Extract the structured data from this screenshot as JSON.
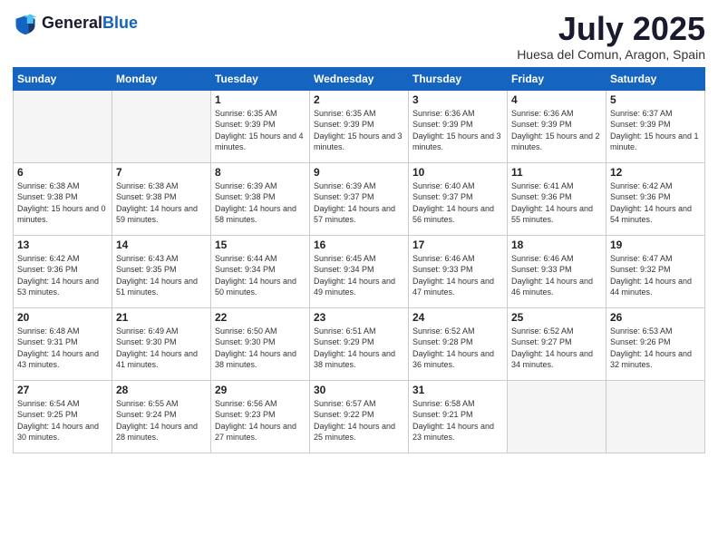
{
  "header": {
    "logo_general": "General",
    "logo_blue": "Blue",
    "month_title": "July 2025",
    "location": "Huesa del Comun, Aragon, Spain"
  },
  "weekdays": [
    "Sunday",
    "Monday",
    "Tuesday",
    "Wednesday",
    "Thursday",
    "Friday",
    "Saturday"
  ],
  "weeks": [
    [
      {
        "day": "",
        "empty": true
      },
      {
        "day": "",
        "empty": true
      },
      {
        "day": "1",
        "sunrise": "Sunrise: 6:35 AM",
        "sunset": "Sunset: 9:39 PM",
        "daylight": "Daylight: 15 hours and 4 minutes."
      },
      {
        "day": "2",
        "sunrise": "Sunrise: 6:35 AM",
        "sunset": "Sunset: 9:39 PM",
        "daylight": "Daylight: 15 hours and 3 minutes."
      },
      {
        "day": "3",
        "sunrise": "Sunrise: 6:36 AM",
        "sunset": "Sunset: 9:39 PM",
        "daylight": "Daylight: 15 hours and 3 minutes."
      },
      {
        "day": "4",
        "sunrise": "Sunrise: 6:36 AM",
        "sunset": "Sunset: 9:39 PM",
        "daylight": "Daylight: 15 hours and 2 minutes."
      },
      {
        "day": "5",
        "sunrise": "Sunrise: 6:37 AM",
        "sunset": "Sunset: 9:39 PM",
        "daylight": "Daylight: 15 hours and 1 minute."
      }
    ],
    [
      {
        "day": "6",
        "sunrise": "Sunrise: 6:38 AM",
        "sunset": "Sunset: 9:38 PM",
        "daylight": "Daylight: 15 hours and 0 minutes."
      },
      {
        "day": "7",
        "sunrise": "Sunrise: 6:38 AM",
        "sunset": "Sunset: 9:38 PM",
        "daylight": "Daylight: 14 hours and 59 minutes."
      },
      {
        "day": "8",
        "sunrise": "Sunrise: 6:39 AM",
        "sunset": "Sunset: 9:38 PM",
        "daylight": "Daylight: 14 hours and 58 minutes."
      },
      {
        "day": "9",
        "sunrise": "Sunrise: 6:39 AM",
        "sunset": "Sunset: 9:37 PM",
        "daylight": "Daylight: 14 hours and 57 minutes."
      },
      {
        "day": "10",
        "sunrise": "Sunrise: 6:40 AM",
        "sunset": "Sunset: 9:37 PM",
        "daylight": "Daylight: 14 hours and 56 minutes."
      },
      {
        "day": "11",
        "sunrise": "Sunrise: 6:41 AM",
        "sunset": "Sunset: 9:36 PM",
        "daylight": "Daylight: 14 hours and 55 minutes."
      },
      {
        "day": "12",
        "sunrise": "Sunrise: 6:42 AM",
        "sunset": "Sunset: 9:36 PM",
        "daylight": "Daylight: 14 hours and 54 minutes."
      }
    ],
    [
      {
        "day": "13",
        "sunrise": "Sunrise: 6:42 AM",
        "sunset": "Sunset: 9:36 PM",
        "daylight": "Daylight: 14 hours and 53 minutes."
      },
      {
        "day": "14",
        "sunrise": "Sunrise: 6:43 AM",
        "sunset": "Sunset: 9:35 PM",
        "daylight": "Daylight: 14 hours and 51 minutes."
      },
      {
        "day": "15",
        "sunrise": "Sunrise: 6:44 AM",
        "sunset": "Sunset: 9:34 PM",
        "daylight": "Daylight: 14 hours and 50 minutes."
      },
      {
        "day": "16",
        "sunrise": "Sunrise: 6:45 AM",
        "sunset": "Sunset: 9:34 PM",
        "daylight": "Daylight: 14 hours and 49 minutes."
      },
      {
        "day": "17",
        "sunrise": "Sunrise: 6:46 AM",
        "sunset": "Sunset: 9:33 PM",
        "daylight": "Daylight: 14 hours and 47 minutes."
      },
      {
        "day": "18",
        "sunrise": "Sunrise: 6:46 AM",
        "sunset": "Sunset: 9:33 PM",
        "daylight": "Daylight: 14 hours and 46 minutes."
      },
      {
        "day": "19",
        "sunrise": "Sunrise: 6:47 AM",
        "sunset": "Sunset: 9:32 PM",
        "daylight": "Daylight: 14 hours and 44 minutes."
      }
    ],
    [
      {
        "day": "20",
        "sunrise": "Sunrise: 6:48 AM",
        "sunset": "Sunset: 9:31 PM",
        "daylight": "Daylight: 14 hours and 43 minutes."
      },
      {
        "day": "21",
        "sunrise": "Sunrise: 6:49 AM",
        "sunset": "Sunset: 9:30 PM",
        "daylight": "Daylight: 14 hours and 41 minutes."
      },
      {
        "day": "22",
        "sunrise": "Sunrise: 6:50 AM",
        "sunset": "Sunset: 9:30 PM",
        "daylight": "Daylight: 14 hours and 38 minutes."
      },
      {
        "day": "23",
        "sunrise": "Sunrise: 6:51 AM",
        "sunset": "Sunset: 9:29 PM",
        "daylight": "Daylight: 14 hours and 38 minutes."
      },
      {
        "day": "24",
        "sunrise": "Sunrise: 6:52 AM",
        "sunset": "Sunset: 9:28 PM",
        "daylight": "Daylight: 14 hours and 36 minutes."
      },
      {
        "day": "25",
        "sunrise": "Sunrise: 6:52 AM",
        "sunset": "Sunset: 9:27 PM",
        "daylight": "Daylight: 14 hours and 34 minutes."
      },
      {
        "day": "26",
        "sunrise": "Sunrise: 6:53 AM",
        "sunset": "Sunset: 9:26 PM",
        "daylight": "Daylight: 14 hours and 32 minutes."
      }
    ],
    [
      {
        "day": "27",
        "sunrise": "Sunrise: 6:54 AM",
        "sunset": "Sunset: 9:25 PM",
        "daylight": "Daylight: 14 hours and 30 minutes."
      },
      {
        "day": "28",
        "sunrise": "Sunrise: 6:55 AM",
        "sunset": "Sunset: 9:24 PM",
        "daylight": "Daylight: 14 hours and 28 minutes."
      },
      {
        "day": "29",
        "sunrise": "Sunrise: 6:56 AM",
        "sunset": "Sunset: 9:23 PM",
        "daylight": "Daylight: 14 hours and 27 minutes."
      },
      {
        "day": "30",
        "sunrise": "Sunrise: 6:57 AM",
        "sunset": "Sunset: 9:22 PM",
        "daylight": "Daylight: 14 hours and 25 minutes."
      },
      {
        "day": "31",
        "sunrise": "Sunrise: 6:58 AM",
        "sunset": "Sunset: 9:21 PM",
        "daylight": "Daylight: 14 hours and 23 minutes."
      },
      {
        "day": "",
        "empty": true
      },
      {
        "day": "",
        "empty": true
      }
    ]
  ]
}
